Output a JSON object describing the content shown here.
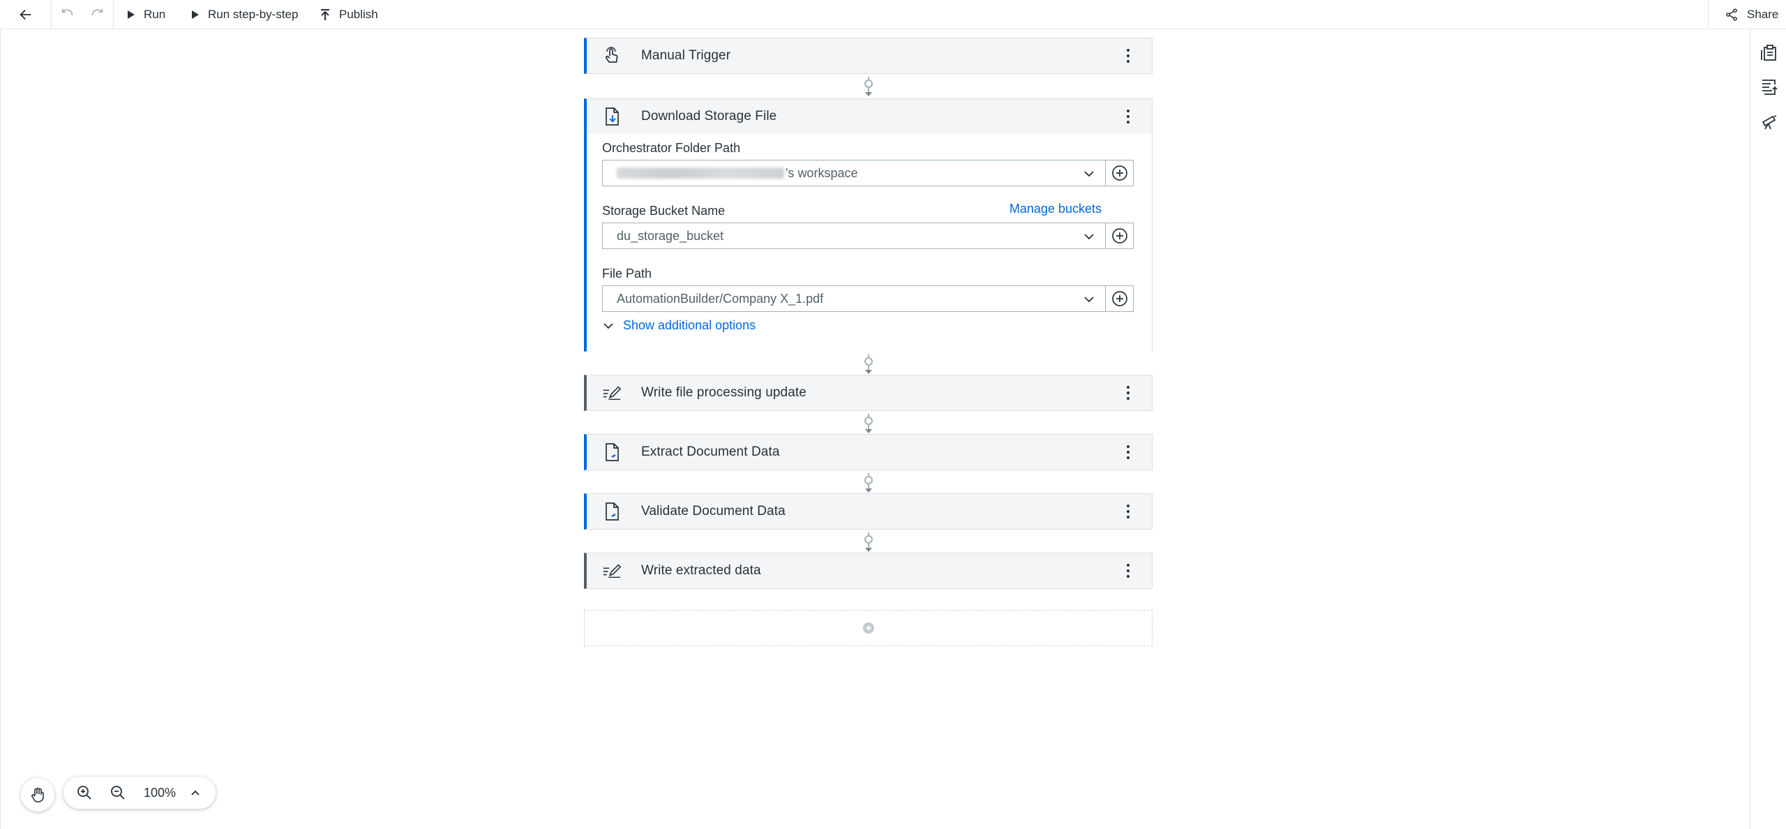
{
  "toolbar": {
    "run_label": "Run",
    "run_step_label": "Run step-by-step",
    "publish_label": "Publish",
    "share_label": "Share"
  },
  "steps": [
    {
      "title": "Manual Trigger",
      "icon": "hand-pointer-icon",
      "accent": "#0067df"
    },
    {
      "title": "Download Storage File",
      "icon": "file-download-icon",
      "accent": "#0067df"
    },
    {
      "title": "Write file processing update",
      "icon": "write-icon",
      "accent": "#526069"
    },
    {
      "title": "Extract Document Data",
      "icon": "document-icon",
      "accent": "#0067df"
    },
    {
      "title": "Validate Document Data",
      "icon": "document-icon",
      "accent": "#0067df"
    },
    {
      "title": "Write extracted data",
      "icon": "write-icon",
      "accent": "#526069"
    }
  ],
  "download_step": {
    "folder_label": "Orchestrator Folder Path",
    "folder_value_suffix": "'s workspace",
    "bucket_label": "Storage Bucket Name",
    "manage_buckets": "Manage buckets",
    "bucket_value": "du_storage_bucket",
    "file_label": "File Path",
    "file_value": "AutomationBuilder/Company X_1.pdf",
    "show_more": "Show additional options"
  },
  "zoom": {
    "level": "100%"
  },
  "colors": {
    "accent": "#0067df",
    "gray_accent": "#526069",
    "step_bg": "#f4f5f7"
  }
}
